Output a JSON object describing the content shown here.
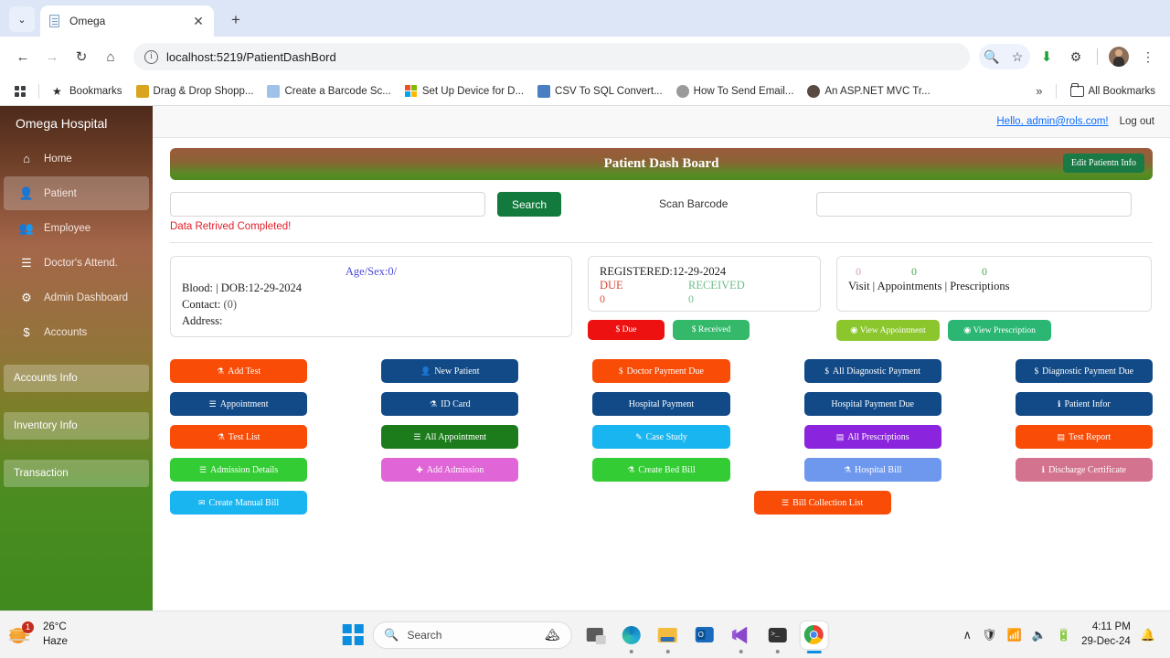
{
  "browser": {
    "tab": {
      "title": "Omega",
      "favicon": "document-icon",
      "close": "✕"
    },
    "new_tab": "+",
    "chevron": "⌄",
    "nav": {
      "back": "←",
      "forward": "→",
      "reload": "↻",
      "home": "⌂"
    },
    "omnibox": {
      "url": "localhost:5219/PatientDashBord",
      "info": "ⓘ"
    },
    "toolbar_icons": [
      "zoom-out-icon",
      "bookmark-star-icon",
      "download-icon",
      "extensions-icon",
      "profile-avatar",
      "more-menu-icon"
    ],
    "bookmarks": [
      {
        "label": "Bookmarks",
        "icon": "star-icon",
        "color": "#2b2b2b"
      },
      {
        "label": "Drag & Drop Shopp...",
        "icon": "site-favicon",
        "color": "#d9a520"
      },
      {
        "label": "Create a Barcode Sc...",
        "icon": "site-favicon",
        "color": "#9fc3e8"
      },
      {
        "label": "Set Up Device for D...",
        "icon": "microsoft-favicon",
        "color": "#f25022"
      },
      {
        "label": "CSV To SQL Convert...",
        "icon": "site-favicon",
        "color": "#4a7fc1"
      },
      {
        "label": "How To Send Email...",
        "icon": "site-favicon",
        "color": "#9a9a9a"
      },
      {
        "label": "An ASP.NET MVC Tr...",
        "icon": "site-favicon",
        "color": "#5a4a42"
      }
    ],
    "bookmarks_overflow": "»",
    "all_bookmarks": "All Bookmarks"
  },
  "app": {
    "brand": "Omega Hospital",
    "sidebar": {
      "items": [
        {
          "label": "Home",
          "icon": "home-icon",
          "glyph": "⌂",
          "active": false
        },
        {
          "label": "Patient",
          "icon": "user-icon",
          "glyph": "♟",
          "active": true
        },
        {
          "label": "Employee",
          "icon": "users-icon",
          "glyph": "♟",
          "active": false
        },
        {
          "label": "Doctor's Attend.",
          "icon": "list-icon",
          "glyph": "☰",
          "active": false
        },
        {
          "label": "Admin Dashboard",
          "icon": "gear-icon",
          "glyph": "⚙",
          "active": false
        },
        {
          "label": "Accounts",
          "icon": "dollar-icon",
          "glyph": "$",
          "active": false
        }
      ],
      "blocks": [
        {
          "label": "Accounts Info"
        },
        {
          "label": "Inventory Info"
        },
        {
          "label": "Transaction"
        }
      ]
    },
    "topbar": {
      "greeting": "Hello, admin@rols.com!",
      "logout": "Log out"
    },
    "banner": {
      "title": "Patient Dash Board",
      "edit_button": "Edit Patientn Info"
    },
    "search": {
      "input_value": "",
      "button_label": "Search",
      "scan_label": "Scan Barcode",
      "barcode_value": "",
      "notice": "Data Retrived Completed!"
    },
    "patient_card": {
      "age_sex": "Age/Sex:0/",
      "blood_dob": "Blood: | DOB:12-29-2024",
      "contact_label": "Contact: ",
      "contact_value": "(0)",
      "address": "Address:"
    },
    "registration_card": {
      "registered_label": "REGISTERED:",
      "registered_date": "12-29-2024",
      "due_label": "DUE",
      "received_label": "RECEIVED",
      "due_value": "0",
      "received_value": "0",
      "due_button": "Due",
      "received_button": "Received"
    },
    "visits_card": {
      "visit_count": "0",
      "appointment_count": "0",
      "prescription_count": "0",
      "labels": "Visit  |  Appointments  |  Prescriptions",
      "view_appointment_button": "View Appointment",
      "view_prescription_button": "View Prescription"
    },
    "action_buttons": [
      {
        "label": "Add Test",
        "icon": "flask-icon",
        "glyph": "⚗",
        "color": "#f84c07"
      },
      {
        "label": "New Patient",
        "icon": "user-add-icon",
        "glyph": "♟",
        "color": "#114a87"
      },
      {
        "label": "Doctor Payment Due",
        "icon": "dollar-icon",
        "glyph": "$",
        "color": "#f84c07"
      },
      {
        "label": "All Diagnostic Payment",
        "icon": "dollar-icon",
        "glyph": "$",
        "color": "#114a87"
      },
      {
        "label": "Diagnostic Payment Due",
        "icon": "dollar-icon",
        "glyph": "$",
        "color": "#114a87"
      },
      {
        "label": "Appointment",
        "icon": "list-icon",
        "glyph": "☰",
        "color": "#114a87"
      },
      {
        "label": "ID Card",
        "icon": "id-card-icon",
        "glyph": "⚗",
        "color": "#114a87"
      },
      {
        "label": "Hospital Payment",
        "icon": "none",
        "glyph": "",
        "color": "#114a87"
      },
      {
        "label": "Hospital Payment Due",
        "icon": "none",
        "glyph": "",
        "color": "#114a87"
      },
      {
        "label": "Patient Infor",
        "icon": "info-icon",
        "glyph": "ℹ",
        "color": "#114a87"
      },
      {
        "label": "Test List",
        "icon": "flask-icon",
        "glyph": "⚗",
        "color": "#f84c07"
      },
      {
        "label": "All Appointment",
        "icon": "list-icon",
        "glyph": "☰",
        "color": "#1c7c1c"
      },
      {
        "label": "Case Study",
        "icon": "pencil-icon",
        "glyph": "✎",
        "color": "#19b5f0"
      },
      {
        "label": "All Prescriptions",
        "icon": "list-alt-icon",
        "glyph": "▤",
        "color": "#8b24dd"
      },
      {
        "label": "Test Report",
        "icon": "list-alt-icon",
        "glyph": "▤",
        "color": "#f84c07"
      },
      {
        "label": "Admission Details",
        "icon": "list-icon",
        "glyph": "☰",
        "color": "#34cc34"
      },
      {
        "label": "Add Admission",
        "icon": "plus-icon",
        "glyph": "✚",
        "color": "#e065d6"
      },
      {
        "label": "Create Bed Bill",
        "icon": "bed-icon",
        "glyph": "⚗",
        "color": "#34cc34"
      },
      {
        "label": "Hospital Bill",
        "icon": "bed-icon",
        "glyph": "⚗",
        "color": "#6e97ee"
      },
      {
        "label": "Discharge Certificate",
        "icon": "info-icon",
        "glyph": "ℹ",
        "color": "#d3738f"
      }
    ],
    "last_row": [
      {
        "label": "Create Manual Bill",
        "icon": "envelope-icon",
        "glyph": "✉",
        "color": "#19b5f0"
      },
      {
        "label": "Bill Collection List",
        "icon": "list-icon",
        "glyph": "☰",
        "color": "#f84c07",
        "column": 3
      }
    ]
  },
  "taskbar": {
    "weather": {
      "temperature": "26°C",
      "condition": "Haze",
      "badge": "1"
    },
    "start": "windows-start-icon",
    "search": {
      "placeholder": "Search",
      "icon": "search-icon"
    },
    "apps": [
      "task-view-icon",
      "edge-icon",
      "file-explorer-icon",
      "outlook-icon",
      "visual-studio-icon",
      "terminal-icon",
      "chrome-icon"
    ],
    "tray": {
      "chevron": "∧",
      "security": "security-icon",
      "wifi": "wifi-icon",
      "volume": "volume-icon",
      "battery": "battery-icon",
      "notification": "notification-icon"
    },
    "clock": {
      "time": "4:11 PM",
      "date": "29-Dec-24"
    }
  }
}
